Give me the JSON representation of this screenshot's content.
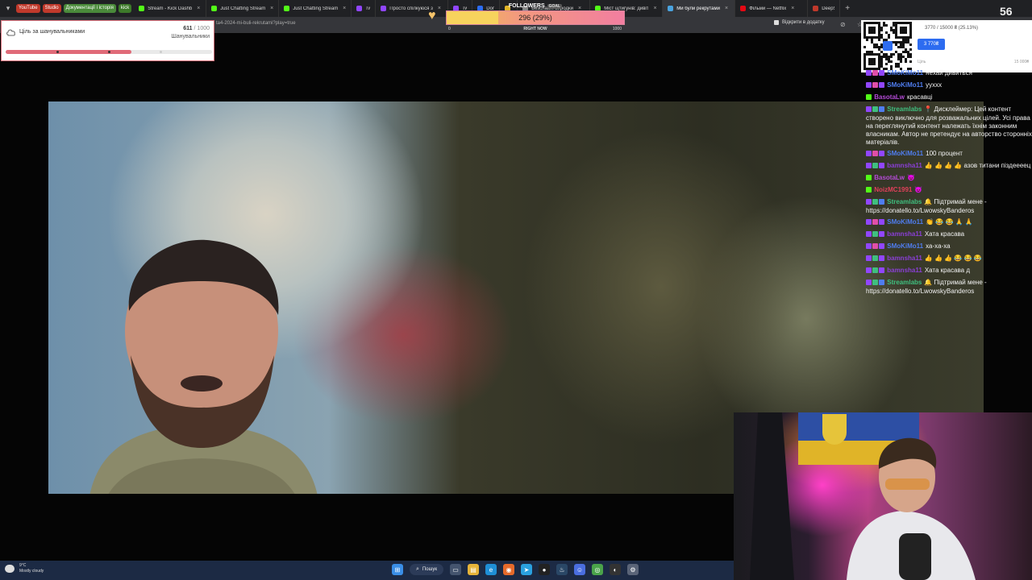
{
  "browser": {
    "bookmarks": [
      {
        "label": "YouTube",
        "color": "#c0392b"
      },
      {
        "label": "Studio",
        "color": "#c0392b"
      },
      {
        "label": "Документації і історія",
        "color": "#4a8a3a"
      },
      {
        "label": "kick",
        "color": "#3d7a2a"
      }
    ],
    "tabs": [
      {
        "label": "Stream - Kick Dashb",
        "fav": "#53fc18",
        "close": "×"
      },
      {
        "label": "Just Chatting Stream",
        "fav": "#53fc18",
        "close": "×"
      },
      {
        "label": "Just Chatting Stream",
        "fav": "#53fc18",
        "close": "×"
      },
      {
        "label": "Twitch",
        "fav": "#9146ff",
        "close": ""
      },
      {
        "label": "Просто спілкуюся з",
        "fav": "#9146ff",
        "close": "×"
      },
      {
        "label": "Twitch",
        "fav": "#9146ff",
        "close": ""
      },
      {
        "label": "Donations",
        "fav": "#2d6cf0",
        "close": ""
      },
      {
        "label": "Ферма",
        "fav": "#e0b428",
        "close": ""
      },
      {
        "label": "Безславні виродки",
        "fav": "#888888",
        "close": "×"
      },
      {
        "label": "Міст щтигунів: дивіт",
        "fav": "#53fc18",
        "close": "×"
      },
      {
        "label": "Ми були рекрутами",
        "fav": "#4aa3df",
        "close": "×"
      },
      {
        "label": "Фільми — Netflix",
        "fav": "#e50914",
        "close": "×"
      },
      {
        "label": "DeepState",
        "fav": "#c0392b",
        "close": ""
      }
    ],
    "active_tab": 10,
    "new_tab": "+",
    "menu_icon": "▾",
    "url": "ta4-2024-mi-buli-rekrutami?play=true",
    "open_in_app": "Відкрити в додатку",
    "address_icons": "⊘ ☆ ⋮"
  },
  "followers": {
    "title": "FOLLOWERS",
    "tag": "GOAL",
    "value": "296 (29%)",
    "progress": 0.29,
    "min": "0",
    "label": "RIGHT NOW",
    "max": "1000",
    "heart_icon": "♥"
  },
  "goal": {
    "title": "Ціль за шанувальниками",
    "current": "611",
    "total": "/ 1000",
    "subtitle": "Шанувальники",
    "progress": 0.61
  },
  "donation": {
    "amount_text": "3770 / 15000 ₴ (25.13%)",
    "badge": "3 770₴",
    "min_label": "Ціль",
    "max_label": "15 000₴",
    "progress": 0.2513
  },
  "corner_number": "56",
  "chat": [
    {
      "user": "SMoKiMo11",
      "color": "#4f7df0",
      "badges": [
        "#9146ff",
        "#e04fa8",
        "#9146ff"
      ],
      "text": "нехай дивиться"
    },
    {
      "user": "SMoKiMo11",
      "color": "#4f7df0",
      "badges": [
        "#9146ff",
        "#e04fa8",
        "#9146ff"
      ],
      "text": "ууххх"
    },
    {
      "user": "BasotaLw",
      "color": "#b44bd6",
      "badges": [
        "#53fc18"
      ],
      "text": "красавці"
    },
    {
      "user": "Streamlabs",
      "color": "#3fbf7f",
      "badges": [
        "#9146ff",
        "#3fbf7f",
        "#4f7df0"
      ],
      "text": "📍 Дисклеймер: Цей контент створено виключно для розважальних цілей. Усі права на переглянутий контент належать їхнім законним власникам. Автор не претендує на авторство сторонніх матеріалів."
    },
    {
      "user": "SMoKiMo11",
      "color": "#4f7df0",
      "badges": [
        "#9146ff",
        "#e04fa8",
        "#9146ff"
      ],
      "text": "100 процент"
    },
    {
      "user": "bamnsha11",
      "color": "#8a3fd6",
      "badges": [
        "#9146ff",
        "#3fbf7f",
        "#9146ff"
      ],
      "text": "👍 👍 👍 👍 азов титани піздеееец"
    },
    {
      "user": "BasotaLw",
      "color": "#b44bd6",
      "badges": [
        "#53fc18"
      ],
      "text": "😈"
    },
    {
      "user": "NoizMC1991",
      "color": "#e0405a",
      "badges": [
        "#53fc18"
      ],
      "text": "😈"
    },
    {
      "user": "Streamlabs",
      "color": "#3fbf7f",
      "badges": [
        "#9146ff",
        "#3fbf7f",
        "#4f7df0"
      ],
      "text": "🔔 Підтримай мене - https://donatello.to/LwowskyBanderos"
    },
    {
      "user": "SMoKiMo11",
      "color": "#4f7df0",
      "badges": [
        "#9146ff",
        "#e04fa8",
        "#9146ff"
      ],
      "text": "👏 😂 😂 🙏 🙏"
    },
    {
      "user": "bamnsha11",
      "color": "#8a3fd6",
      "badges": [
        "#9146ff",
        "#3fbf7f",
        "#9146ff"
      ],
      "text": "Хата красава"
    },
    {
      "user": "SMoKiMo11",
      "color": "#4f7df0",
      "badges": [
        "#9146ff",
        "#e04fa8",
        "#9146ff"
      ],
      "text": "ха-ха-ха"
    },
    {
      "user": "bamnsha11",
      "color": "#8a3fd6",
      "badges": [
        "#9146ff",
        "#3fbf7f",
        "#9146ff"
      ],
      "text": "👍 👍 👍 😂 😂 😂"
    },
    {
      "user": "bamnsha11",
      "color": "#8a3fd6",
      "badges": [
        "#9146ff",
        "#3fbf7f",
        "#9146ff"
      ],
      "text": "Хата красава д"
    },
    {
      "user": "Streamlabs",
      "color": "#3fbf7f",
      "badges": [
        "#9146ff",
        "#3fbf7f",
        "#4f7df0"
      ],
      "text": "🔔 Підтримай мене - https://donatello.to/LwowskyBanderos"
    }
  ],
  "taskbar": {
    "weather_temp": "9°C",
    "weather_desc": "Mostly cloudy",
    "search_label": "Пошук",
    "search_icon": "⌕",
    "apps": [
      {
        "name": "windows-start-icon",
        "color": "#3a8ee6",
        "glyph": "⊞"
      },
      {
        "name": "task-view-icon",
        "color": "#44546e",
        "glyph": "▭"
      },
      {
        "name": "file-explorer-icon",
        "color": "#e6b43a",
        "glyph": "▤"
      },
      {
        "name": "edge-icon",
        "color": "#1f8fd6",
        "glyph": "e"
      },
      {
        "name": "firefox-icon",
        "color": "#e66a2a",
        "glyph": "◉"
      },
      {
        "name": "telegram-icon",
        "color": "#2aa1e0",
        "glyph": "➤"
      },
      {
        "name": "obs-icon",
        "color": "#222222",
        "glyph": "●"
      },
      {
        "name": "steam-icon",
        "color": "#2a4766",
        "glyph": "♨"
      },
      {
        "name": "discord-icon",
        "color": "#4a6ee0",
        "glyph": "☺"
      },
      {
        "name": "chrome-icon",
        "color": "#4aa34a",
        "glyph": "◎"
      },
      {
        "name": "github-icon",
        "color": "#333333",
        "glyph": "◐"
      },
      {
        "name": "settings-icon",
        "color": "#5a6478",
        "glyph": "⚙"
      }
    ]
  }
}
